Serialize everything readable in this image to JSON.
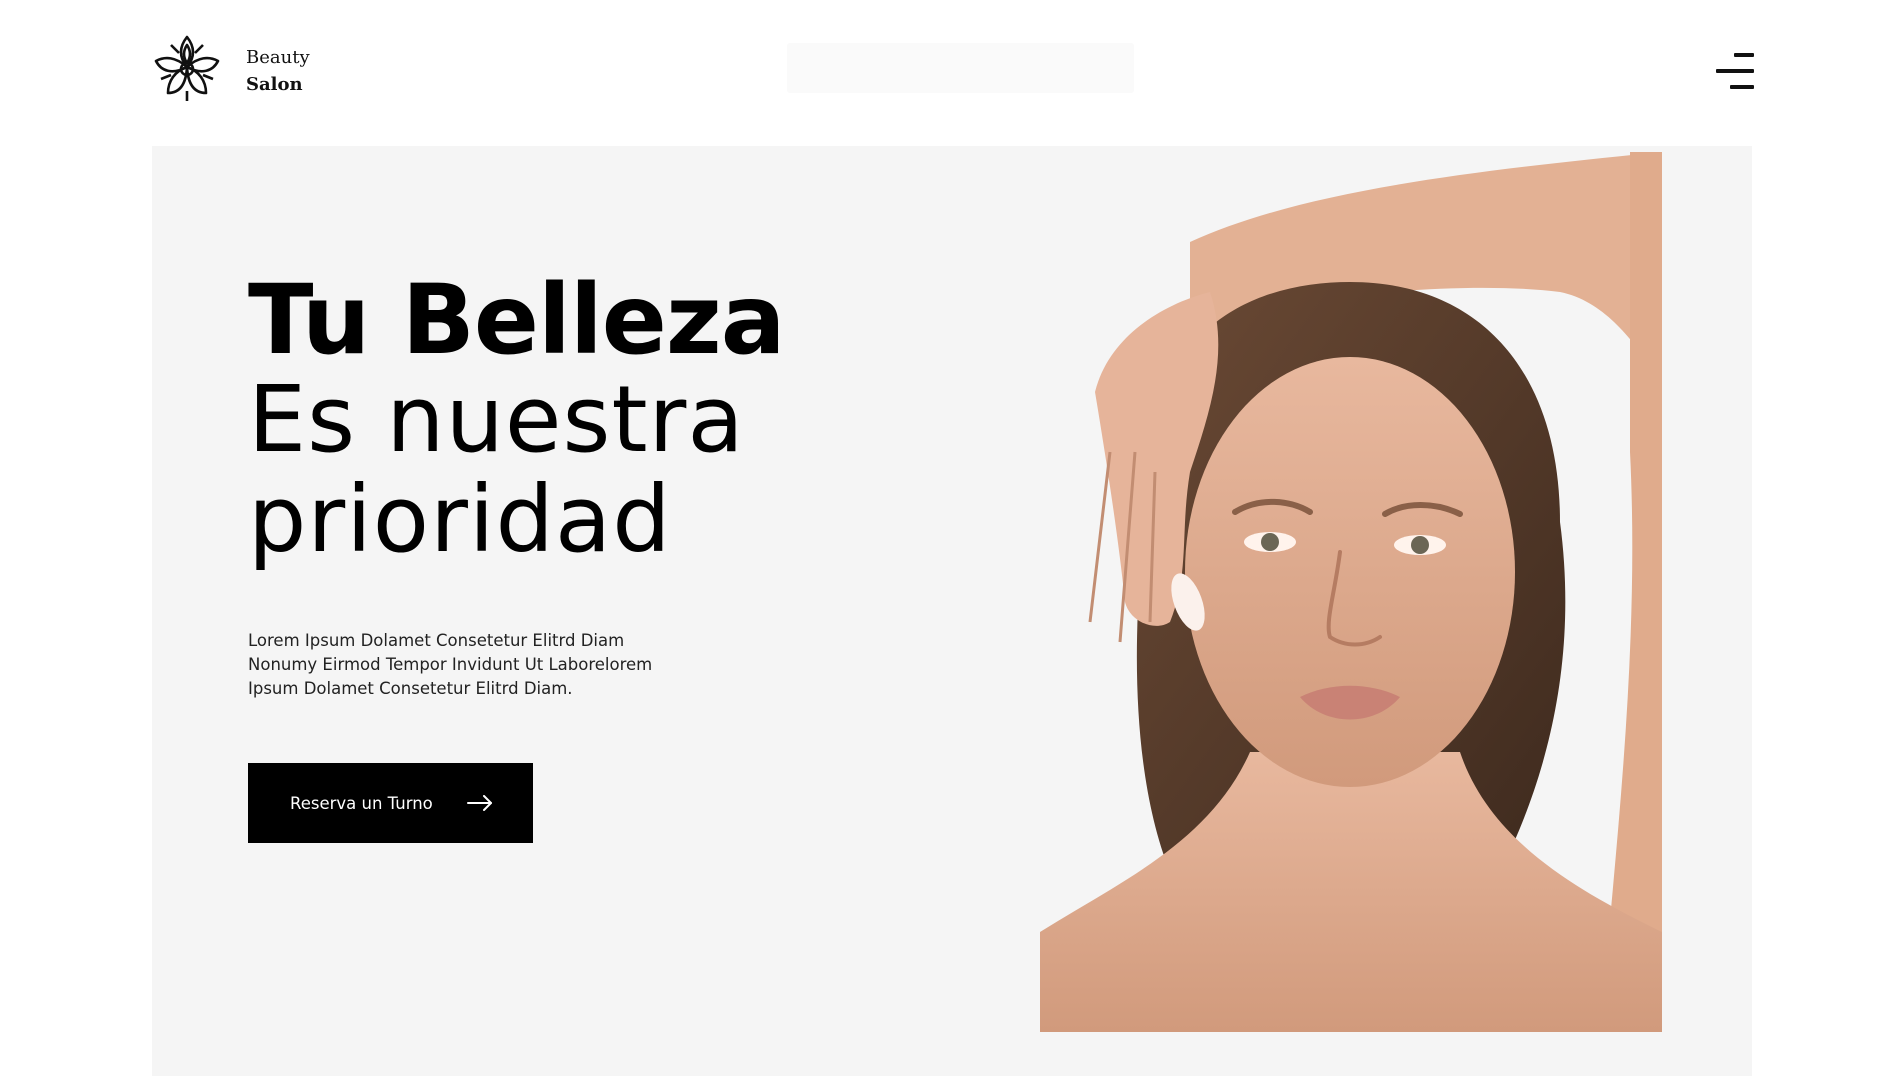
{
  "brand": {
    "line1": "Beauty",
    "line2": "Salon"
  },
  "hero": {
    "title_bold": "Tu Belleza",
    "title_light_1": "Es nuestra",
    "title_light_2": "prioridad",
    "description": "Lorem Ipsum Dolamet Consetetur Elitrd Diam Nonumy Eirmod Tempor Invidunt Ut Laborelorem Ipsum Dolamet Consetetur Elitrd Diam.",
    "cta_label": "Reserva un Turno"
  },
  "icons": {
    "logo": "lotus-mandala-icon",
    "menu": "hamburger-menu-icon",
    "cta_arrow": "arrow-right-icon"
  },
  "colors": {
    "hero_background": "#f5f5f5",
    "cta_background": "#000000",
    "text": "#000000"
  }
}
